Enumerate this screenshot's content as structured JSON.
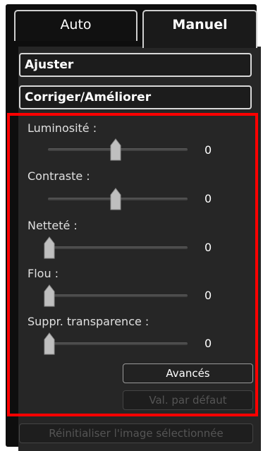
{
  "tabs": {
    "auto": "Auto",
    "manuel": "Manuel"
  },
  "sections": {
    "ajuster": "Ajuster",
    "corriger": "Corriger/Améliorer"
  },
  "sliders": [
    {
      "label": "Luminosité :",
      "value": "0",
      "position": 0.5
    },
    {
      "label": "Contraste :",
      "value": "0",
      "position": 0.5
    },
    {
      "label": "Netteté :",
      "value": "0",
      "position": 0.0
    },
    {
      "label": "Flou :",
      "value": "0",
      "position": 0.0
    },
    {
      "label": "Suppr. transparence :",
      "value": "0",
      "position": 0.0
    }
  ],
  "buttons": {
    "avances": "Avancés",
    "val_defaut": "Val. par défaut",
    "reset_image": "Réinitialiser l'image sélectionnée"
  },
  "colors": {
    "highlight": "#ff0000",
    "panel_bg": "#262626"
  }
}
